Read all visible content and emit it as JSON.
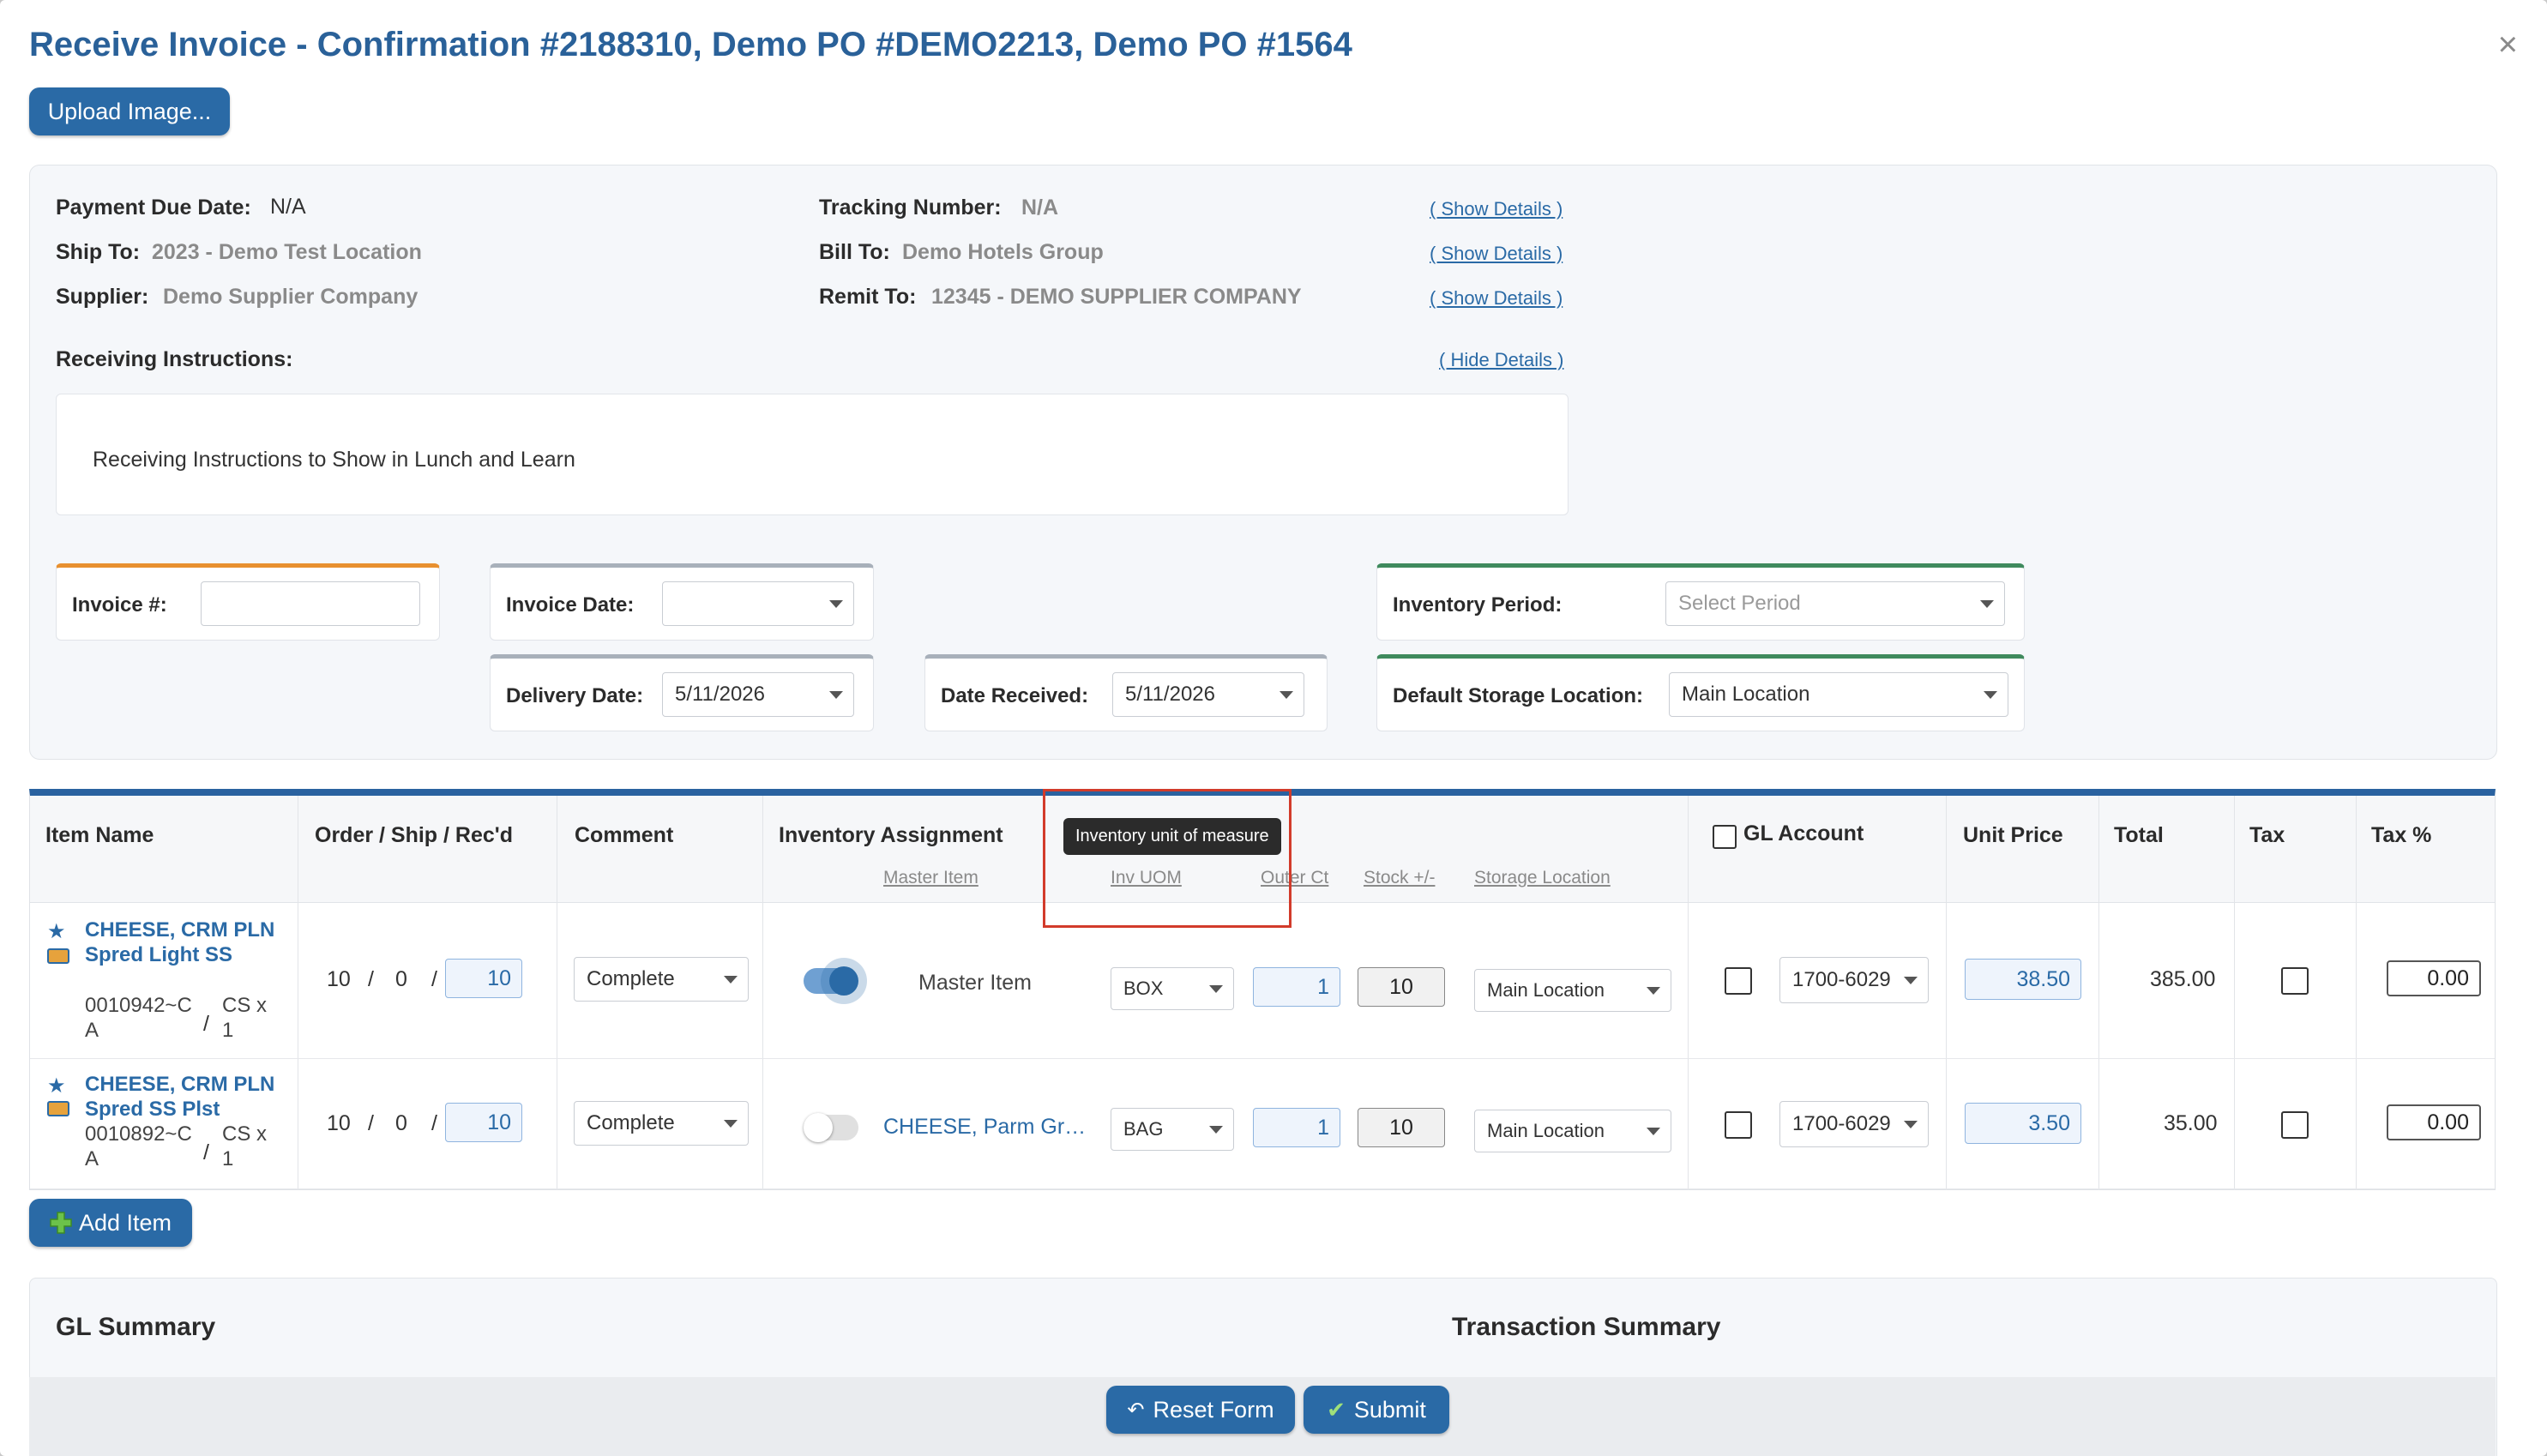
{
  "modal": {
    "title": "Receive Invoice - Confirmation #2188310, Demo PO #DEMO2213, Demo PO #1564",
    "close": "×",
    "upload_label": "Upload Image..."
  },
  "info": {
    "payment_due_label": "Payment Due Date:",
    "payment_due_value": "N/A",
    "ship_to_label": "Ship To:",
    "ship_to_value": "2023 - Demo Test Location",
    "supplier_label": "Supplier:",
    "supplier_value": "Demo Supplier Company",
    "tracking_label": "Tracking Number:",
    "tracking_value": "N/A",
    "bill_to_label": "Bill To:",
    "bill_to_value": "Demo Hotels Group",
    "remit_to_label": "Remit To:",
    "remit_to_value": "12345 - DEMO SUPPLIER COMPANY",
    "show_details": "( Show Details )",
    "hide_details": "( Hide Details )",
    "receiving_instructions_label": "Receiving Instructions:",
    "receiving_instructions_text": "Receiving Instructions to Show in Lunch and Learn"
  },
  "form": {
    "invoice_no_label": "Invoice #:",
    "invoice_no_value": "",
    "invoice_date_label": "Invoice Date:",
    "invoice_date_value": "",
    "delivery_date_label": "Delivery Date:",
    "delivery_date_value": "5/11/2026",
    "date_received_label": "Date Received:",
    "date_received_value": "5/11/2026",
    "inventory_period_label": "Inventory Period:",
    "inventory_period_placeholder": "Select Period",
    "default_storage_label": "Default Storage Location:",
    "default_storage_value": "Main Location"
  },
  "table": {
    "headers": {
      "item_name": "Item Name",
      "order_ship_recd": "Order / Ship / Rec'd",
      "comment": "Comment",
      "inventory_assignment": "Inventory Assignment",
      "gl_account": "GL Account",
      "unit_price": "Unit Price",
      "total": "Total",
      "tax": "Tax",
      "tax_pct": "Tax %"
    },
    "subheaders": {
      "master_item": "Master Item",
      "inv_uom": "Inv UOM",
      "outer_ct": "Outer Ct",
      "stock": "Stock +/-",
      "storage_location": "Storage Location"
    },
    "tooltip": "Inventory unit of measure",
    "rows": [
      {
        "name": "CHEESE, CRM PLN Spred Light SS",
        "code": "0010942~C A",
        "unit": "CS x 1",
        "order": "10",
        "ship": "0",
        "recd": "10",
        "comment": "Complete",
        "assignment": "Master Item",
        "uom": "BOX",
        "outer_ct": "1",
        "stock": "10",
        "storage": "Main Location",
        "gl": "1700-6029",
        "unit_price": "38.50",
        "total": "385.00",
        "tax_pct": "0.00"
      },
      {
        "name": "CHEESE, CRM PLN Spred SS Plst",
        "code": "0010892~C A",
        "unit": "CS x 1",
        "order": "10",
        "ship": "0",
        "recd": "10",
        "comment": "Complete",
        "assignment": "CHEESE, Parm Gr…",
        "uom": "BAG",
        "outer_ct": "1",
        "stock": "10",
        "storage": "Main Location",
        "gl": "1700-6029",
        "unit_price": "3.50",
        "total": "35.00",
        "tax_pct": "0.00"
      }
    ],
    "slash": "/"
  },
  "actions": {
    "add_item": "Add Item",
    "reset": "Reset Form",
    "submit": "Submit"
  },
  "summary": {
    "gl_summary": "GL Summary",
    "transaction_summary": "Transaction Summary"
  }
}
